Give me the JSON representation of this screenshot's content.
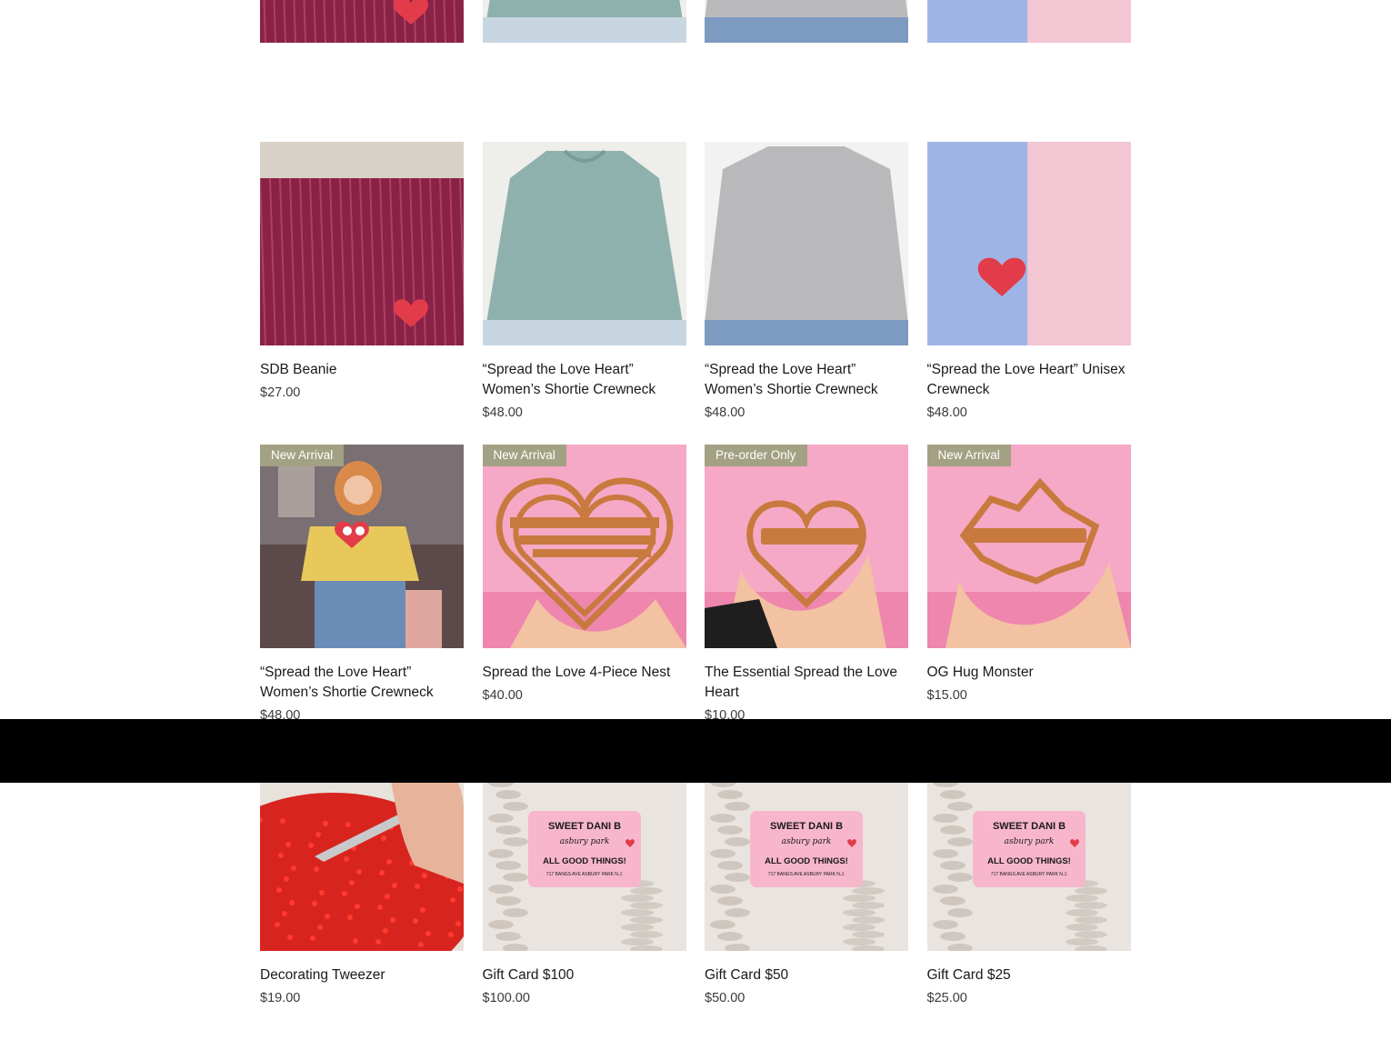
{
  "products": [
    {
      "title": "",
      "price": "",
      "badge": "",
      "image": "beanie"
    },
    {
      "title": "",
      "price": "",
      "badge": "",
      "image": "sage-crewneck"
    },
    {
      "title": "",
      "price": "",
      "badge": "",
      "image": "grey-crewneck"
    },
    {
      "title": "",
      "price": "",
      "badge": "",
      "image": "pink-crewneck"
    },
    {
      "title": "SDB Beanie",
      "price": "$27.00",
      "badge": "",
      "image": "beanie"
    },
    {
      "title": "“Spread the Love Heart” Women’s Shortie Crewneck",
      "price": "$48.00",
      "badge": "",
      "image": "sage-crewneck"
    },
    {
      "title": "“Spread the Love Heart” Women’s Shortie Crewneck",
      "price": "$48.00",
      "badge": "",
      "image": "grey-crewneck"
    },
    {
      "title": "“Spread the Love Heart” Unisex Crewneck",
      "price": "$48.00",
      "badge": "",
      "image": "pink-crewneck"
    },
    {
      "title": "“Spread the Love Heart” Women’s Shortie Crewneck",
      "price": "$48.00",
      "badge": "New Arrival",
      "image": "yellow-crewneck"
    },
    {
      "title": "Spread the Love 4-Piece Nest",
      "price": "$40.00",
      "badge": "New Arrival",
      "image": "cutter-nest"
    },
    {
      "title": "The Essential Spread the Love Heart",
      "price": "$10.00",
      "badge": "Pre-order Only",
      "image": "cutter-heart"
    },
    {
      "title": "OG Hug Monster",
      "price": "$15.00",
      "badge": "New Arrival",
      "image": "cutter-monster"
    },
    {
      "title": "Decorating Tweezer",
      "price": "$19.00",
      "badge": "",
      "image": "tweezer"
    },
    {
      "title": "Gift Card $100",
      "price": "$100.00",
      "badge": "",
      "image": "gift-card"
    },
    {
      "title": "Gift Card $50",
      "price": "$50.00",
      "badge": "",
      "image": "gift-card"
    },
    {
      "title": "Gift Card $25",
      "price": "$25.00",
      "badge": "",
      "image": "gift-card"
    }
  ],
  "giftcard": {
    "brand": "SWEET DANI B",
    "script": "asbury park",
    "tagline": "ALL GOOD THINGS!",
    "address": "717 BANGS AVE ASBURY PARK N.J."
  },
  "colors": {
    "badge": "#a3a183",
    "footer": "#000000",
    "pink_bg": "#f5a9c6",
    "cutter": "#c87a3e"
  }
}
